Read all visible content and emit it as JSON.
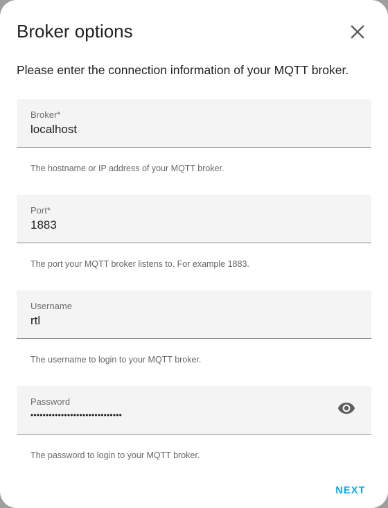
{
  "dialog": {
    "title": "Broker options",
    "description": "Please enter the connection information of your MQTT broker.",
    "close_icon": "close-icon"
  },
  "fields": [
    {
      "label": "Broker*",
      "value": "localhost",
      "helper": "The hostname or IP address of your MQTT broker."
    },
    {
      "label": "Port*",
      "value": "1883",
      "helper": "The port your MQTT broker listens to. For example 1883."
    },
    {
      "label": "Username",
      "value": "rtl",
      "helper": "The username to login to your MQTT broker."
    },
    {
      "label": "Password",
      "value": "••••••••••••••••••••••••••••••",
      "helper": "The password to login to your MQTT broker.",
      "toggle_icon": "eye-icon"
    }
  ],
  "actions": {
    "next_label": "NEXT"
  },
  "colors": {
    "accent": "#03a9f4",
    "field_background": "#f4f4f4",
    "text_primary": "#212121",
    "text_secondary": "#666666"
  }
}
